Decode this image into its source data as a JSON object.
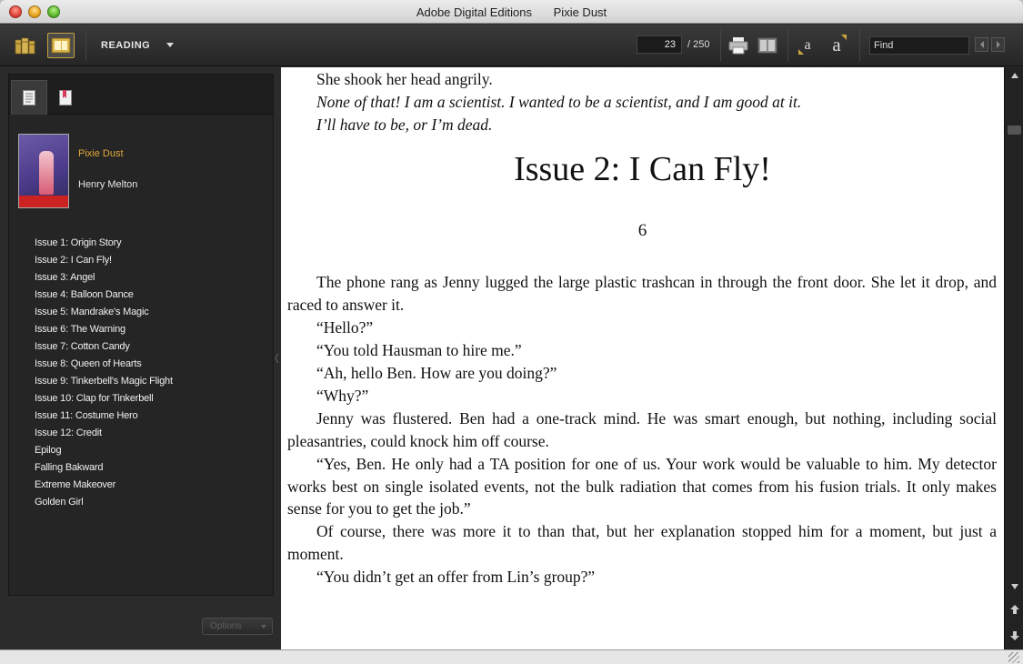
{
  "window": {
    "app_name": "Adobe Digital Editions",
    "doc_name": "Pixie Dust"
  },
  "toolbar": {
    "library_icon": "library-icon",
    "reading_icon": "reading-view-icon",
    "mode_label": "READING",
    "current_page": "23",
    "total_pages": "/ 250",
    "print_icon": "print-icon",
    "book_icon": "book-view-icon",
    "font_small": "a",
    "font_large": "a",
    "find_placeholder": "Find",
    "accent": "#c9a441"
  },
  "sidebar": {
    "book_title": "Pixie Dust",
    "book_author": "Henry Melton",
    "toc": [
      "Issue 1: Origin Story",
      "Issue 2: I Can Fly!",
      "Issue 3: Angel",
      "Issue 4: Balloon Dance",
      "Issue 5: Mandrake's Magic",
      "Issue 6: The Warning",
      "Issue 7: Cotton Candy",
      "Issue 8: Queen of Hearts",
      "Issue 9: Tinkerbell's Magic Flight",
      "Issue 10: Clap for Tinkerbell",
      "Issue 11: Costume Hero",
      "Issue 12: Credit",
      "Epilog",
      "Falling Bakward",
      "Extreme Makeover",
      "Golden Girl"
    ],
    "options_label": "Options",
    "title_color": "#e2a83a"
  },
  "content": {
    "lines_before": [
      "She shook her head angrily.",
      "None of that! I am a scientist. I wanted to be a scientist, and I am good at it.",
      "I’ll have to be, or I’m dead."
    ],
    "chapter_title": "Issue 2: I Can Fly!",
    "chapter_number": "6",
    "paragraphs": [
      "The phone rang as Jenny lugged the large plastic trashcan in through the front door. She let it drop, and raced to answer it.",
      "“Hello?”",
      "“You told Hausman to hire me.”",
      "“Ah, hello Ben. How are you doing?”",
      "“Why?”",
      "Jenny was flustered. Ben had a one-track mind. He was smart enough, but nothing, including social pleasantries, could knock him off course.",
      "“Yes, Ben. He only had a TA position for one of us. Your work would be valuable to him. My detector works best on single isolated events, not the bulk radiation that comes from his fusion trials. It only makes sense for you to get the job.”",
      "Of course, there was more it to than that, but her explanation stopped him for a moment, but just a moment.",
      "“You didn’t get an offer from Lin’s group?”"
    ]
  }
}
